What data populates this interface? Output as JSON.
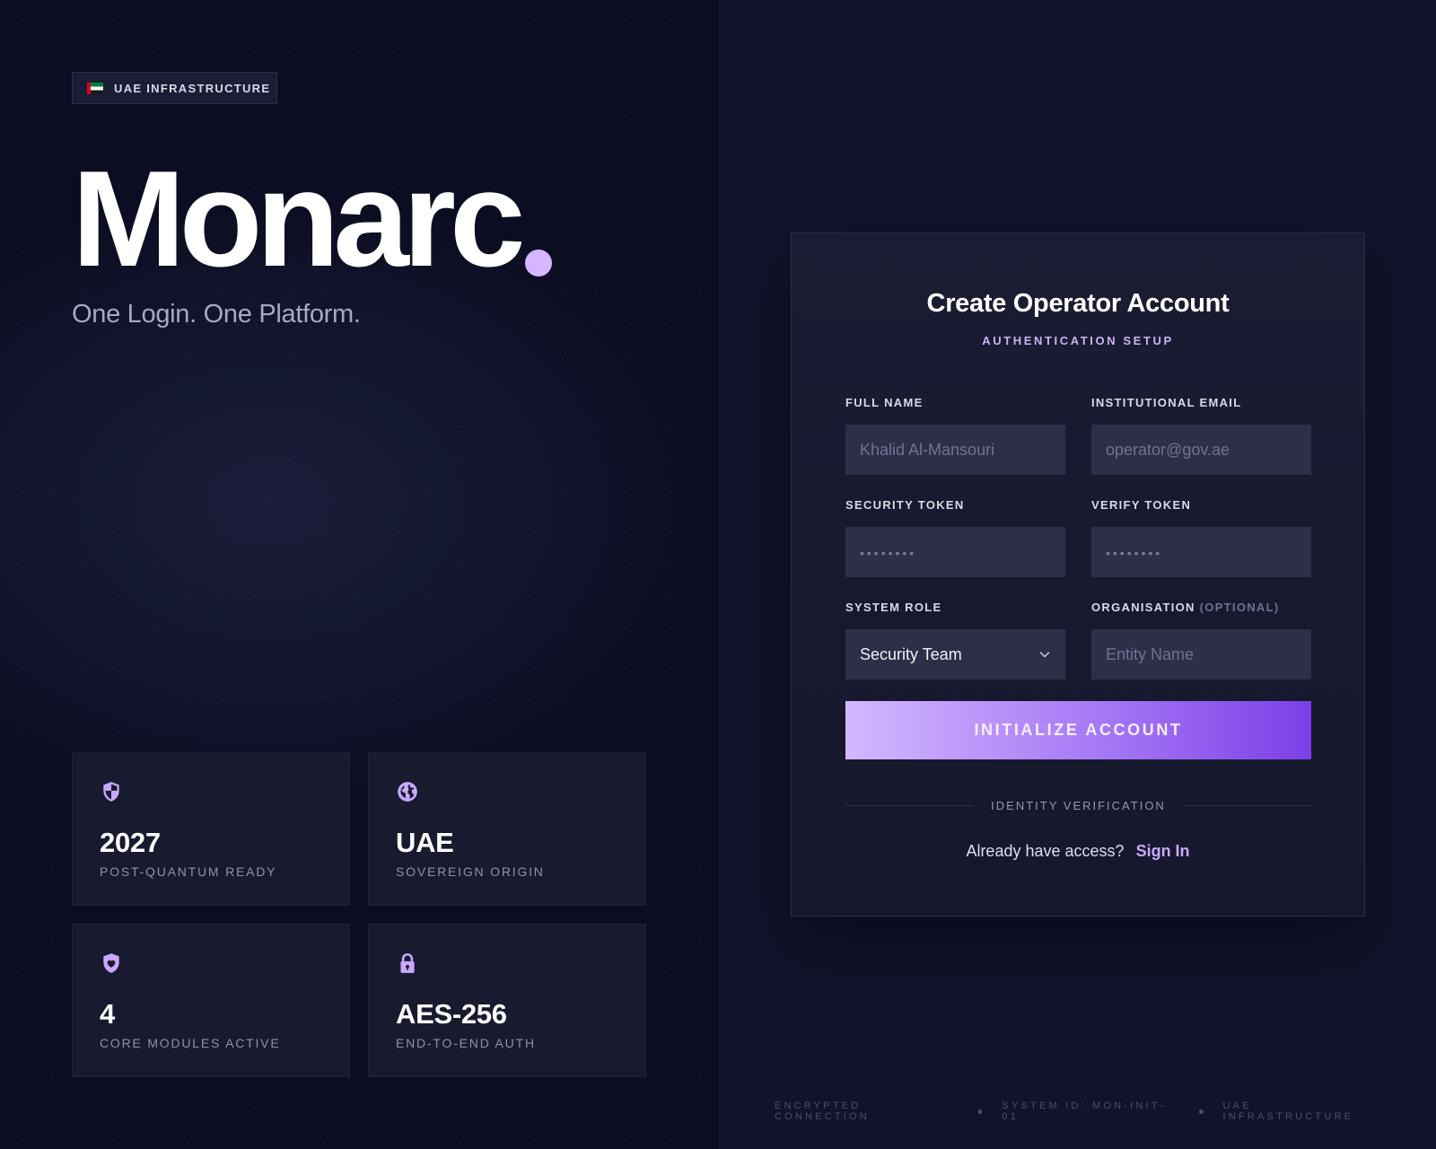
{
  "badge": {
    "text": "UAE INFRASTRUCTURE",
    "flag_colors": [
      "#e0001b",
      "#ffffff",
      "#000000"
    ]
  },
  "brand": {
    "name": "Monarc",
    "accent_color": "#d6b6ff"
  },
  "tagline": "One Login. One Platform.",
  "stats": [
    {
      "icon": "shield-half-icon",
      "value": "2027",
      "label": "POST-QUANTUM READY"
    },
    {
      "icon": "globe-icon",
      "value": "UAE",
      "label": "SOVEREIGN ORIGIN"
    },
    {
      "icon": "shield-heart-icon",
      "value": "4",
      "label": "CORE MODULES ACTIVE"
    },
    {
      "icon": "lock-icon",
      "value": "AES-256",
      "label": "END-TO-END AUTH"
    }
  ],
  "form": {
    "title": "Create Operator Account",
    "subtitle": "AUTHENTICATION SETUP",
    "full_name": {
      "label": "FULL NAME",
      "placeholder": "Khalid Al-Mansouri"
    },
    "email": {
      "label": "INSTITUTIONAL EMAIL",
      "placeholder": "operator@gov.ae"
    },
    "security_token": {
      "label": "SECURITY TOKEN",
      "placeholder": "••••••••"
    },
    "verify_token": {
      "label": "VERIFY TOKEN",
      "placeholder": "••••••••"
    },
    "system_role": {
      "label": "SYSTEM ROLE",
      "selected": "Security Team"
    },
    "organisation": {
      "label": "ORGANISATION",
      "optional": "(OPTIONAL)",
      "placeholder": "Entity Name"
    },
    "submit_label": "INITIALIZE ACCOUNT",
    "divider_text": "IDENTITY VERIFICATION",
    "signin_prompt": "Already have access?",
    "signin_link": "Sign In"
  },
  "footer": {
    "items": [
      "ENCRYPTED CONNECTION",
      "SYSTEM ID: MON-INIT-01",
      "UAE INFRASTRUCTURE"
    ]
  }
}
